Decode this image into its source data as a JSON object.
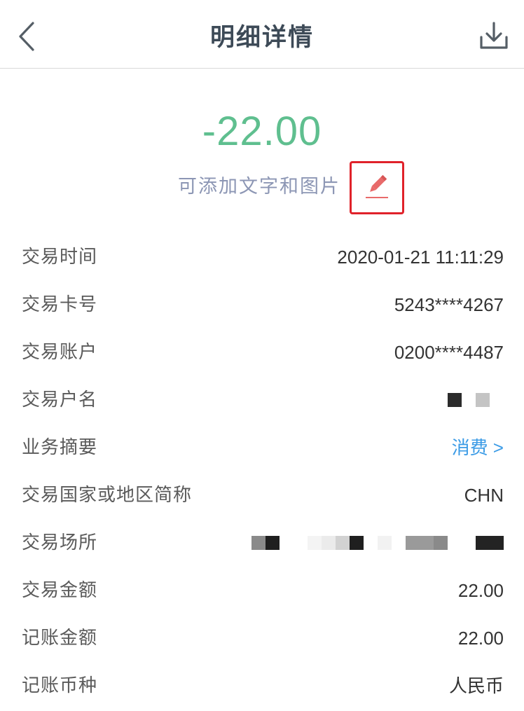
{
  "header": {
    "title": "明细详情",
    "back_icon": "chevron-left-icon",
    "download_icon": "download-icon"
  },
  "summary": {
    "amount": "-22.00",
    "note_prompt": "可添加文字和图片",
    "edit_icon": "pencil-icon"
  },
  "colors": {
    "amount": "#5fbf8f",
    "link": "#3b9be6",
    "highlight_border": "#e0222a",
    "edit_icon": "#e86a6a"
  },
  "details": [
    {
      "label": "交易时间",
      "value": "2020-01-21 11:11:29"
    },
    {
      "label": "交易卡号",
      "value": "5243****4267"
    },
    {
      "label": "交易账户",
      "value": "0200****4487"
    },
    {
      "label": "交易户名",
      "value": ""
    },
    {
      "label": "业务摘要",
      "value": "消费 >"
    },
    {
      "label": "交易国家或地区简称",
      "value": "CHN"
    },
    {
      "label": "交易场所",
      "value": ""
    },
    {
      "label": "交易金额",
      "value": "22.00"
    },
    {
      "label": "记账金额",
      "value": "22.00"
    },
    {
      "label": "记账币种",
      "value": "人民币"
    }
  ]
}
